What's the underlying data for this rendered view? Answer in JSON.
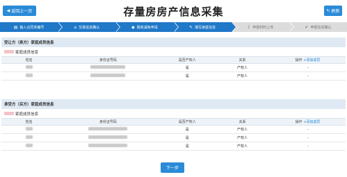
{
  "header": {
    "back_label": "返回上一页",
    "title": "存量房房产信息采集",
    "refresh_label": "刷新"
  },
  "steps": [
    {
      "label": "输入合同单编号",
      "icon": "file-icon",
      "state": "done"
    },
    {
      "label": "交易信息确认",
      "icon": "house-icon",
      "state": "done"
    },
    {
      "label": "税收减免申请",
      "icon": "tag-icon",
      "state": "done"
    },
    {
      "label": "填写家庭信息",
      "icon": "edit-icon",
      "state": "active"
    },
    {
      "label": "申报材料上传",
      "icon": "upload-icon",
      "state": "todo"
    },
    {
      "label": "申报信息确认",
      "icon": "check-icon",
      "state": "todo"
    }
  ],
  "buyer_section": {
    "title": "受让方（卖方）家庭成员信息",
    "subtitle": "家庭成员信息",
    "columns": [
      "姓名",
      "身份证号码",
      "是否产权人",
      "关系",
      "操作"
    ],
    "add_label": "+添加成员",
    "rows": [
      {
        "owner": "是",
        "relation": "产权人",
        "op": "-"
      },
      {
        "owner": "是",
        "relation": "产权人",
        "op": "-"
      }
    ]
  },
  "seller_section": {
    "title": "承受方（买方）家庭成员信息",
    "subtitle": "家庭成员信息",
    "columns": [
      "姓名",
      "身份证号码",
      "是否产权人",
      "关系",
      "操作"
    ],
    "add_label": "+添加成员",
    "rows": [
      {
        "owner": "是",
        "relation": "产权人",
        "op": "-"
      },
      {
        "owner": "是",
        "relation": "产权人",
        "op": "-"
      },
      {
        "owner": "是",
        "relation": "产权人",
        "op": "-"
      }
    ]
  },
  "next_label": "下一步",
  "colors": {
    "primary": "#2a8bd8",
    "step_done": "#1f78c8",
    "step_todo": "#dcdcdc",
    "section_bg": "#dfe9f3"
  }
}
